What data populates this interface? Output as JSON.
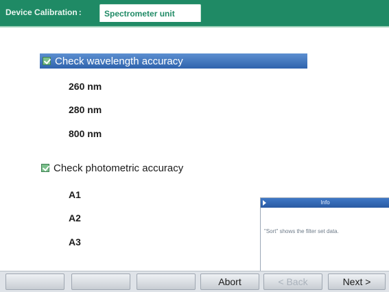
{
  "header": {
    "context": "Device Calibration",
    "tab": "Spectrometer unit"
  },
  "wavelength": {
    "label": "Check wavelength accuracy",
    "items": [
      "260 nm",
      "280 nm",
      "800 nm"
    ]
  },
  "photometric": {
    "label": "Check photometric accuracy",
    "items": [
      "A1",
      "A2",
      "A3"
    ]
  },
  "info_popup": {
    "title": "Info",
    "text": "\"Sort\" shows the filter set data."
  },
  "footer": {
    "buttons": [
      "",
      "",
      "",
      "Abort",
      "< Back",
      "Next >"
    ]
  }
}
